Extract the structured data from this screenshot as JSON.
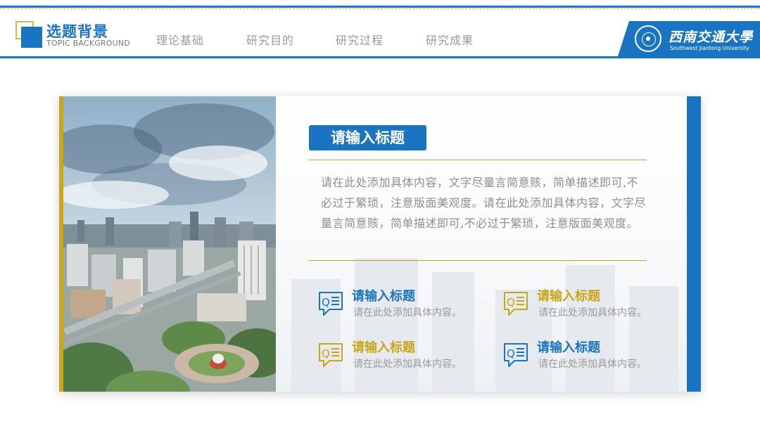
{
  "header": {
    "active_title": "选题背景",
    "active_subtitle": "TOPIC BACKGROUND",
    "nav": [
      {
        "label": "理论基础"
      },
      {
        "label": "研究目的"
      },
      {
        "label": "研究过程"
      },
      {
        "label": "研究成果"
      }
    ],
    "university_name": "西南交通大學",
    "university_name_en": "Southwest Jiaotong University"
  },
  "colors": {
    "primary_blue": "#1a74c2",
    "gold": "#c9a619",
    "text_gray": "#8e8e8e"
  },
  "main": {
    "title": "请输入标题",
    "paragraph": "请在此处添加具体内容，文字尽量言简意赅，简单描述即可,不必过于繁琐，注意版面美观度。请在此处添加具体内容，文字尽量言简意赅，简单描述即可,不必过于繁琐，注意版面美观度。",
    "features": [
      {
        "icon": "qa-chat-icon",
        "title": "请输入标题",
        "desc": "请在此处添加具体内容。",
        "color": "#1a74c2"
      },
      {
        "icon": "qa-chat-icon",
        "title": "请输入标题",
        "desc": "请在此处添加具体内容。",
        "color": "#c9a619"
      },
      {
        "icon": "qa-chat-icon",
        "title": "请输入标题",
        "desc": "请在此处添加具体内容。",
        "color": "#c9a619"
      },
      {
        "icon": "qa-chat-icon",
        "title": "请输入标题",
        "desc": "请在此处添加具体内容。",
        "color": "#1a74c2"
      }
    ]
  }
}
